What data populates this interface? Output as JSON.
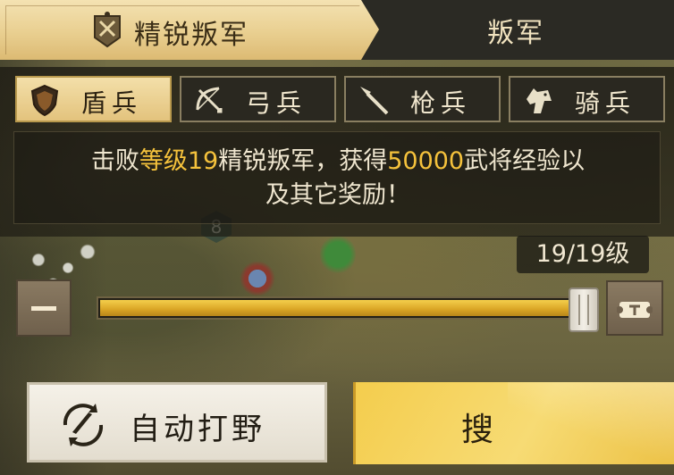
{
  "tabs": {
    "elite_label": "精锐叛军",
    "rebel_label": "叛军"
  },
  "troop_types": [
    {
      "label": "盾兵",
      "icon": "shield-icon",
      "active": true
    },
    {
      "label": "弓兵",
      "icon": "bow-arrow-icon",
      "active": false
    },
    {
      "label": "枪兵",
      "icon": "spear-icon",
      "active": false
    },
    {
      "label": "骑兵",
      "icon": "horse-icon",
      "active": false
    }
  ],
  "description": {
    "part1": "击败",
    "highlight1": "等级19",
    "part2": "精锐叛军，获得",
    "highlight2": "50000",
    "part3": "武将经验以",
    "line2": "及其它奖励！"
  },
  "map": {
    "hex_number": "8"
  },
  "level": {
    "current": 19,
    "max": 19,
    "display": "19/19级"
  },
  "buttons": {
    "auto_hunt_label": "自动打野",
    "search_label": "搜"
  },
  "colors": {
    "highlight": "#f5c23c",
    "active_tab": "#e9cf90",
    "slider_fill": "#d9a424",
    "search_button": "#f4cd4d"
  }
}
